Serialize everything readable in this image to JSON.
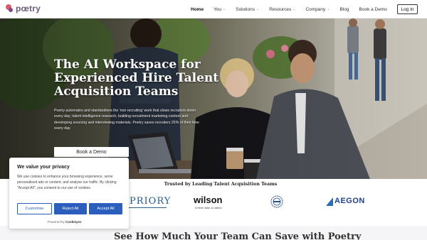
{
  "nav": {
    "logo_text": "pœtry",
    "items": [
      {
        "label": "Home",
        "active": true,
        "dropdown": false
      },
      {
        "label": "You",
        "active": false,
        "dropdown": true
      },
      {
        "label": "Solutions",
        "active": false,
        "dropdown": true
      },
      {
        "label": "Resources",
        "active": false,
        "dropdown": true
      },
      {
        "label": "Company",
        "active": false,
        "dropdown": true
      },
      {
        "label": "Blog",
        "active": false,
        "dropdown": false
      },
      {
        "label": "Book a Demo",
        "active": false,
        "dropdown": false
      }
    ],
    "login_label": "Log In"
  },
  "hero": {
    "title": "The AI Workspace for Experienced Hire Talent Acquisition Teams",
    "description": "Poetry automates and standardises the 'non recruiting' work that slows recruiters down every day; talent intelligence research, building recruitment marketing content and developing sourcing and interviewing materials. Poetry saves recruiters 25% of their time every day.",
    "cta_label": "Book a Demo"
  },
  "trusted": {
    "title": "Trusted by Leading Talent Acquisition Teams",
    "logos": [
      {
        "name": "PRIORY",
        "icon": "priory-logo"
      },
      {
        "name": "wilson",
        "tagline": "A fresh take on talent",
        "icon": "wilson-logo"
      },
      {
        "name": "seal",
        "icon": "seal-logo"
      },
      {
        "name": "AEGON",
        "icon": "aegon-logo"
      }
    ]
  },
  "next_section": {
    "heading": "See How Much Your Team Can Save with Poetry"
  },
  "cookie": {
    "title": "We value your privacy",
    "text": "We use cookies to enhance your browsing experience, serve personalised ads or content, and analyse our traffic. By clicking \"Accept All\", you consent to our use of cookies.",
    "customise_label": "Customise",
    "reject_label": "Reject All",
    "accept_label": "Accept All",
    "powered_prefix": "Powered by",
    "powered_brand": "Cookieyes"
  },
  "colors": {
    "brand_pink": "#d95a6a",
    "brand_purple": "#7a4b8c",
    "cookie_blue": "#2c5fbd"
  }
}
